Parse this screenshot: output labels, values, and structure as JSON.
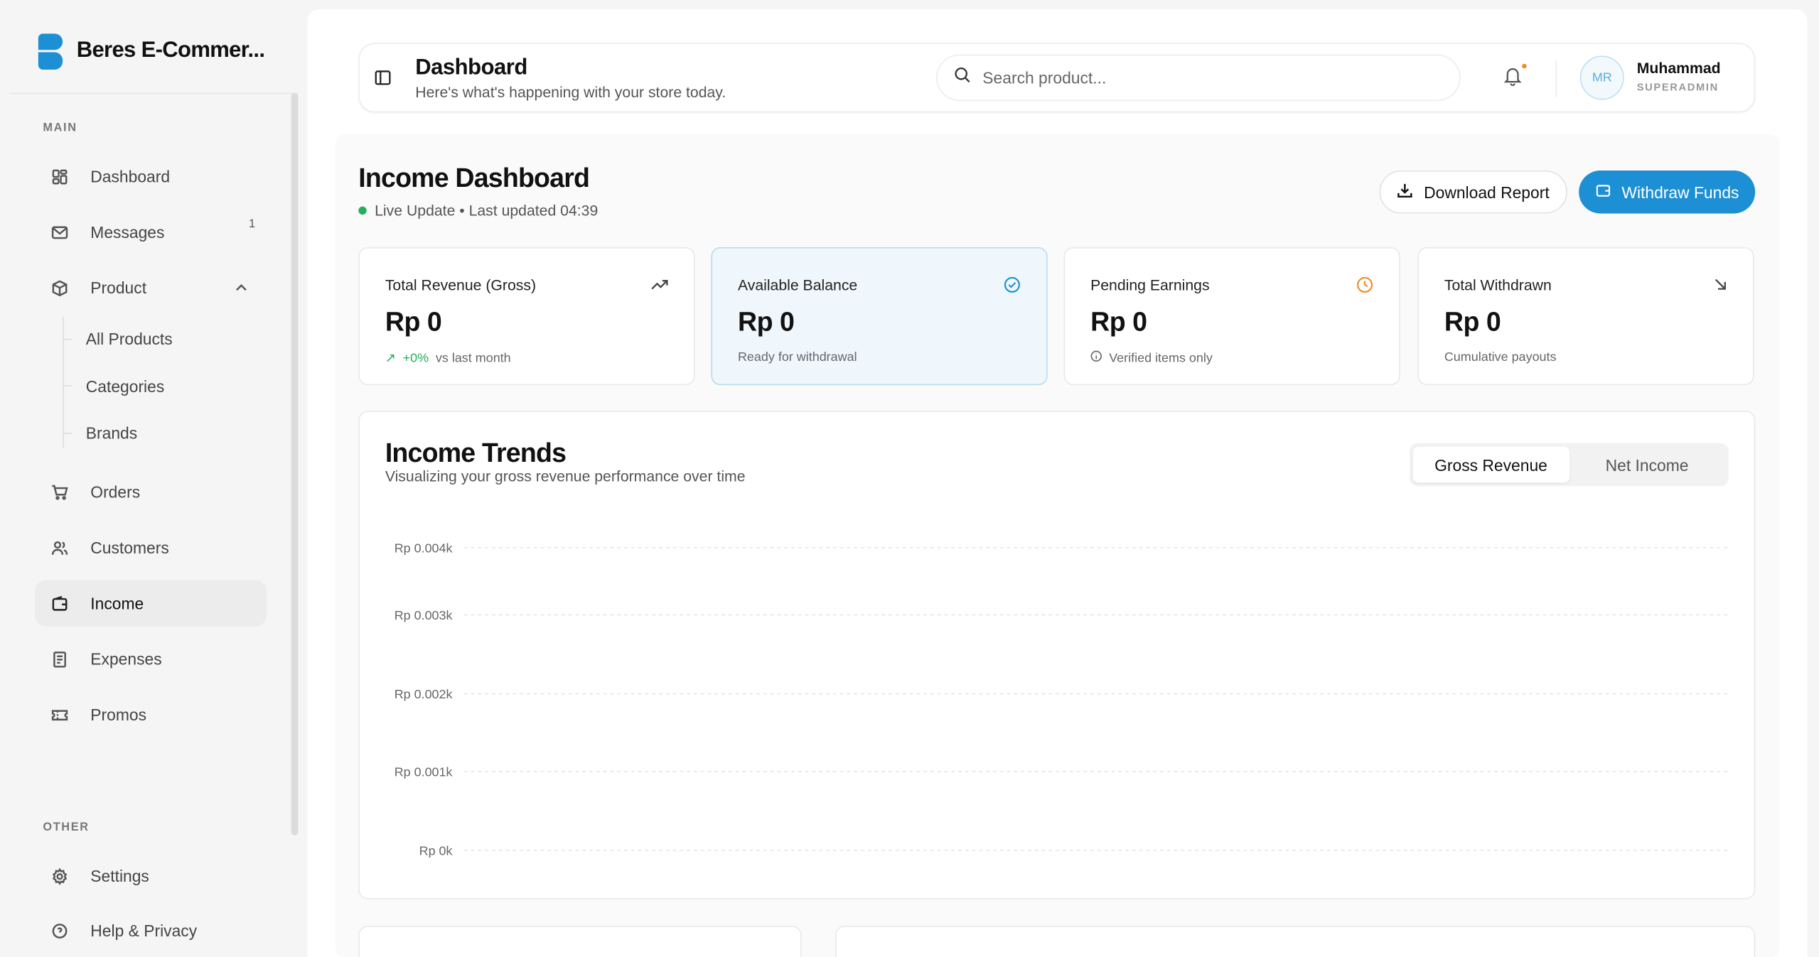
{
  "brand": {
    "name": "Beres E-Commer..."
  },
  "sidebar": {
    "main_label": "MAIN",
    "other_label": "OTHER",
    "items": [
      {
        "label": "Dashboard",
        "icon": "grid-icon"
      },
      {
        "label": "Messages",
        "icon": "mail-icon",
        "badge": "1"
      },
      {
        "label": "Product",
        "icon": "box-icon",
        "expanded": true,
        "children": [
          "All Products",
          "Categories",
          "Brands"
        ]
      },
      {
        "label": "Orders",
        "icon": "cart-icon"
      },
      {
        "label": "Customers",
        "icon": "users-icon"
      },
      {
        "label": "Income",
        "icon": "wallet-icon",
        "active": true
      },
      {
        "label": "Expenses",
        "icon": "receipt-icon"
      },
      {
        "label": "Promos",
        "icon": "ticket-icon"
      }
    ],
    "other_items": [
      {
        "label": "Settings",
        "icon": "gear-icon"
      },
      {
        "label": "Help & Privacy",
        "icon": "help-icon"
      }
    ]
  },
  "header": {
    "title": "Dashboard",
    "subtitle": "Here's what's happening with your store today.",
    "search_placeholder": "Search product...",
    "user": {
      "initials": "MR",
      "name": "Muhammad",
      "role": "SUPERADMIN"
    }
  },
  "page": {
    "title": "Income Dashboard",
    "live_status": "Live Update • Last updated 04:39",
    "download_label": "Download Report",
    "withdraw_label": "Withdraw Funds"
  },
  "cards": [
    {
      "title": "Total Revenue (Gross)",
      "value": "Rp 0",
      "change": "+0%",
      "foot": "vs last month",
      "icon": "trending-up-icon"
    },
    {
      "title": "Available Balance",
      "value": "Rp 0",
      "foot": "Ready for withdrawal",
      "icon": "check-circle-icon"
    },
    {
      "title": "Pending Earnings",
      "value": "Rp 0",
      "foot": "Verified items only",
      "icon": "clock-icon"
    },
    {
      "title": "Total Withdrawn",
      "value": "Rp 0",
      "foot": "Cumulative payouts",
      "icon": "arrow-down-right-icon"
    }
  ],
  "trends": {
    "title": "Income Trends",
    "subtitle": "Visualizing your gross revenue performance over time",
    "tabs": [
      "Gross Revenue",
      "Net Income"
    ],
    "active_tab": "Gross Revenue"
  },
  "chart_data": {
    "type": "line",
    "y_ticks": [
      "Rp 0.004k",
      "Rp 0.003k",
      "Rp 0.002k",
      "Rp 0.001k",
      "Rp 0k"
    ],
    "ylim": [
      0,
      0.004
    ],
    "grid": true,
    "series": []
  },
  "colors": {
    "accent": "#1d8fd4",
    "positive": "#22b05c",
    "warning": "#f08a2b"
  }
}
